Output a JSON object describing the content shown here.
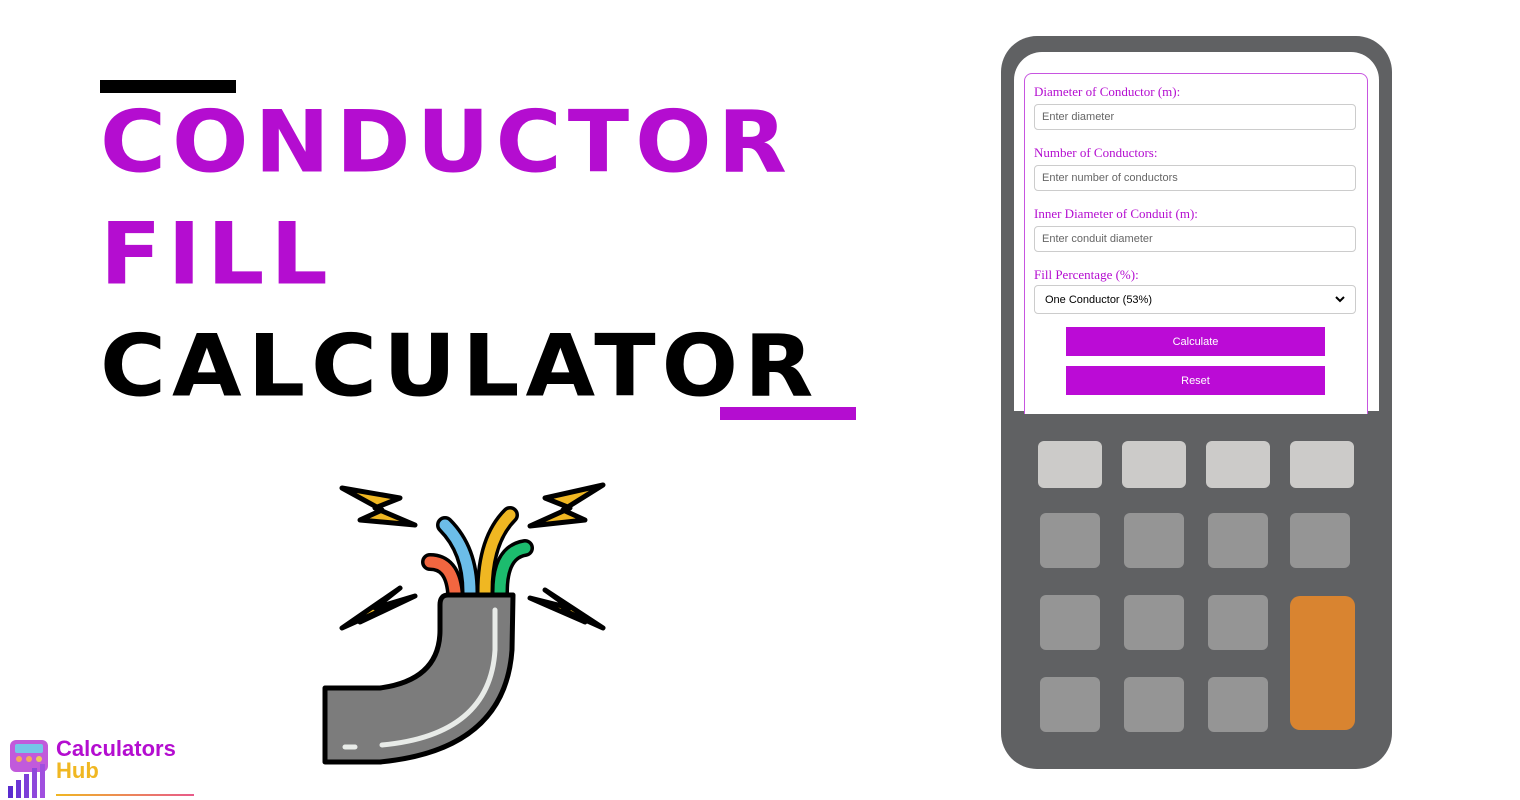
{
  "title": {
    "line1": "CONDUCTOR",
    "line2": "FILL",
    "line3": "CALCULATOR"
  },
  "colors": {
    "accent": "#b40dd0",
    "calculator_body": "#606163",
    "key_light": "#cccbc9",
    "key_mid": "#959595",
    "key_orange": "#d98430"
  },
  "form": {
    "fields": [
      {
        "label": "Diameter of Conductor (m):",
        "placeholder": "Enter diameter",
        "value": ""
      },
      {
        "label": "Number of Conductors:",
        "placeholder": "Enter number of conductors",
        "value": ""
      },
      {
        "label": "Inner Diameter of Conduit (m):",
        "placeholder": "Enter conduit diameter",
        "value": ""
      }
    ],
    "fill_label": "Fill Percentage (%):",
    "fill_selected": "One Conductor (53%)",
    "calculate_label": "Calculate",
    "reset_label": "Reset"
  },
  "logo": {
    "line1": "Calculators",
    "line2": "Hub"
  },
  "icons": {
    "illustration": "broken-cable-sparks-icon",
    "select_arrow": "chevron-down-icon"
  }
}
